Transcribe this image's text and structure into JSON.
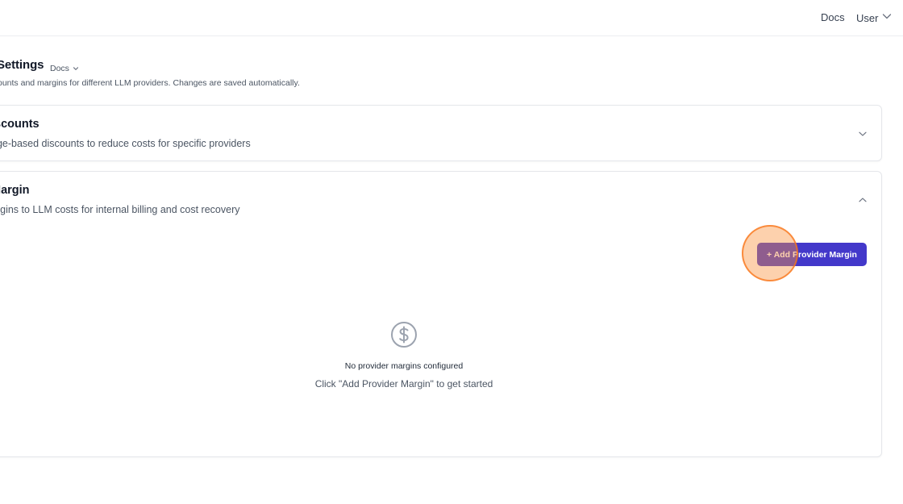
{
  "header": {
    "docs_link": "Docs",
    "user_menu_label": "User"
  },
  "page": {
    "title": "Settings",
    "docs_dropdown_label": "Docs",
    "subtitle": "ounts and margins for different LLM providers. Changes are saved automatically."
  },
  "sections": {
    "discounts": {
      "title": "iscounts",
      "description": "age-based discounts to reduce costs for specific providers",
      "expanded": false
    },
    "margin": {
      "title": "Margin",
      "description": "argins to LLM costs for internal billing and cost recovery",
      "expanded": true,
      "add_button_label": "+ Add Provider Margin",
      "empty_state": {
        "icon": "dollar-circle-icon",
        "title": "No provider margins configured",
        "hint": "Click \"Add Provider Margin\" to get started"
      }
    }
  },
  "colors": {
    "primary": "#4338ca",
    "click_indicator": "#f97316"
  }
}
